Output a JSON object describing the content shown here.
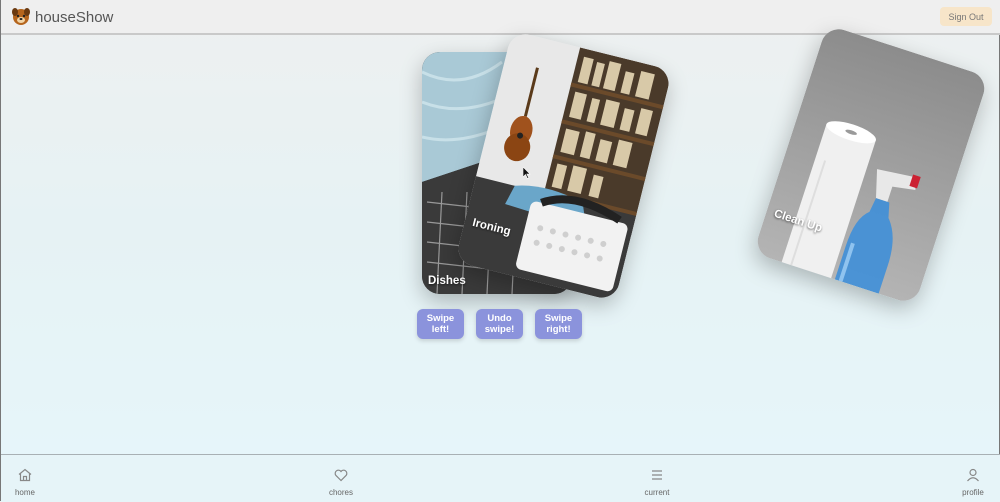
{
  "header": {
    "app_title": "houseShow",
    "logo_icon": "dog-face-icon",
    "sign_out_label": "Sign Out"
  },
  "cards": [
    {
      "label": "Dishes",
      "image": "dishwasher-photo"
    },
    {
      "label": "Ironing",
      "image": "laundry-basket-guitar-bookshelf-photo"
    },
    {
      "label": "Clean Up",
      "image": "paper-towel-spray-bottle-photo"
    }
  ],
  "controls": {
    "swipe_left": "Swipe\nleft!",
    "undo_swipe": "Undo\nswipe!",
    "swipe_right": "Swipe\nright!"
  },
  "nav": {
    "items": [
      {
        "label": "home",
        "icon": "home-icon"
      },
      {
        "label": "chores",
        "icon": "heart-icon"
      },
      {
        "label": "current",
        "icon": "menu-icon"
      },
      {
        "label": "profile",
        "icon": "user-icon"
      }
    ]
  },
  "colors": {
    "button": "#8b93dc",
    "sign_out_bg": "#f7e5c9"
  }
}
